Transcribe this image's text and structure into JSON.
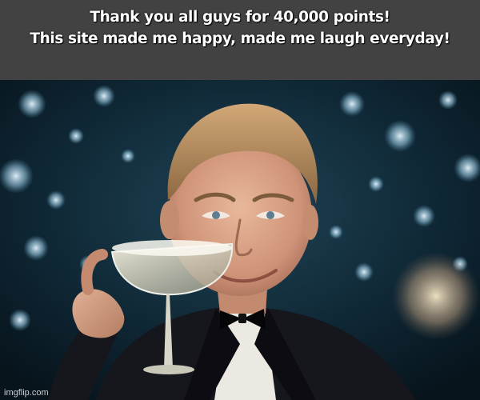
{
  "caption": {
    "line1": "Thank you all guys for 40,000 points!",
    "line2": "This site made me happy, made me laugh everyday!"
  },
  "watermark": "imgflip.com",
  "colors": {
    "caption_bar": "#424242",
    "caption_text": "#ffffff",
    "suit": "#16161d",
    "background": "#0d2533"
  }
}
